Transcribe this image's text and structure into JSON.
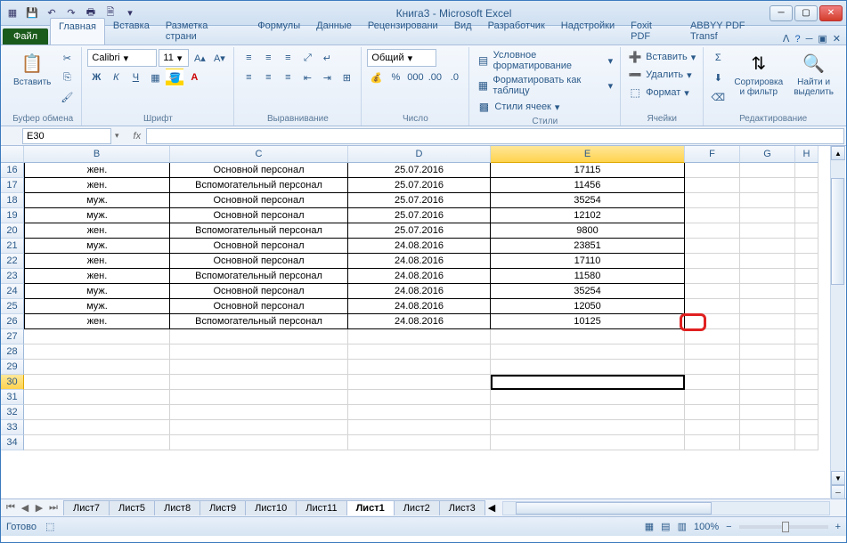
{
  "title": "Книга3  -  Microsoft Excel",
  "qat": {
    "save": "💾",
    "undo": "↶",
    "redo": "↷",
    "print": "🖶",
    "preview": "🗎"
  },
  "file_tab": "Файл",
  "tabs": [
    "Главная",
    "Вставка",
    "Разметка страни",
    "Формулы",
    "Данные",
    "Рецензировани",
    "Вид",
    "Разработчик",
    "Надстройки",
    "Foxit PDF",
    "ABBYY PDF Transf"
  ],
  "ribbon": {
    "clipboard": {
      "paste": "Вставить",
      "label": "Буфер обмена"
    },
    "font": {
      "name": "Calibri",
      "size": "11",
      "label": "Шрифт"
    },
    "align": {
      "label": "Выравнивание"
    },
    "number": {
      "fmt": "Общий",
      "label": "Число"
    },
    "styles": {
      "cond": "Условное форматирование",
      "table": "Форматировать как таблицу",
      "cell": "Стили ячеек",
      "label": "Стили"
    },
    "cells": {
      "insert": "Вставить",
      "delete": "Удалить",
      "format": "Формат",
      "label": "Ячейки"
    },
    "editing": {
      "sort": "Сортировка\nи фильтр",
      "find": "Найти и\nвыделить",
      "label": "Редактирование"
    }
  },
  "namebox": "E30",
  "columns": [
    "B",
    "C",
    "D",
    "E",
    "F",
    "G",
    "H"
  ],
  "sel_col": "E",
  "rows": [
    {
      "n": 16,
      "b": "жен.",
      "c": "Основной персонал",
      "d": "25.07.2016",
      "e": "17115"
    },
    {
      "n": 17,
      "b": "жен.",
      "c": "Вспомогательный персонал",
      "d": "25.07.2016",
      "e": "11456"
    },
    {
      "n": 18,
      "b": "муж.",
      "c": "Основной персонал",
      "d": "25.07.2016",
      "e": "35254"
    },
    {
      "n": 19,
      "b": "муж.",
      "c": "Основной персонал",
      "d": "25.07.2016",
      "e": "12102"
    },
    {
      "n": 20,
      "b": "жен.",
      "c": "Вспомогательный персонал",
      "d": "25.07.2016",
      "e": "9800"
    },
    {
      "n": 21,
      "b": "муж.",
      "c": "Основной персонал",
      "d": "24.08.2016",
      "e": "23851"
    },
    {
      "n": 22,
      "b": "жен.",
      "c": "Основной персонал",
      "d": "24.08.2016",
      "e": "17110"
    },
    {
      "n": 23,
      "b": "жен.",
      "c": "Вспомогательный персонал",
      "d": "24.08.2016",
      "e": "11580"
    },
    {
      "n": 24,
      "b": "муж.",
      "c": "Основной персонал",
      "d": "24.08.2016",
      "e": "35254"
    },
    {
      "n": 25,
      "b": "муж.",
      "c": "Основной персонал",
      "d": "24.08.2016",
      "e": "12050"
    },
    {
      "n": 26,
      "b": "жен.",
      "c": "Вспомогательный персонал",
      "d": "24.08.2016",
      "e": "10125"
    }
  ],
  "empty_rows": [
    27,
    28,
    29,
    30,
    31,
    32,
    33,
    34
  ],
  "sel_row": 30,
  "sheets": [
    "Лист7",
    "Лист5",
    "Лист8",
    "Лист9",
    "Лист10",
    "Лист11",
    "Лист1",
    "Лист2",
    "Лист3"
  ],
  "active_sheet": "Лист1",
  "status": {
    "ready": "Готово",
    "zoom": "100%"
  }
}
